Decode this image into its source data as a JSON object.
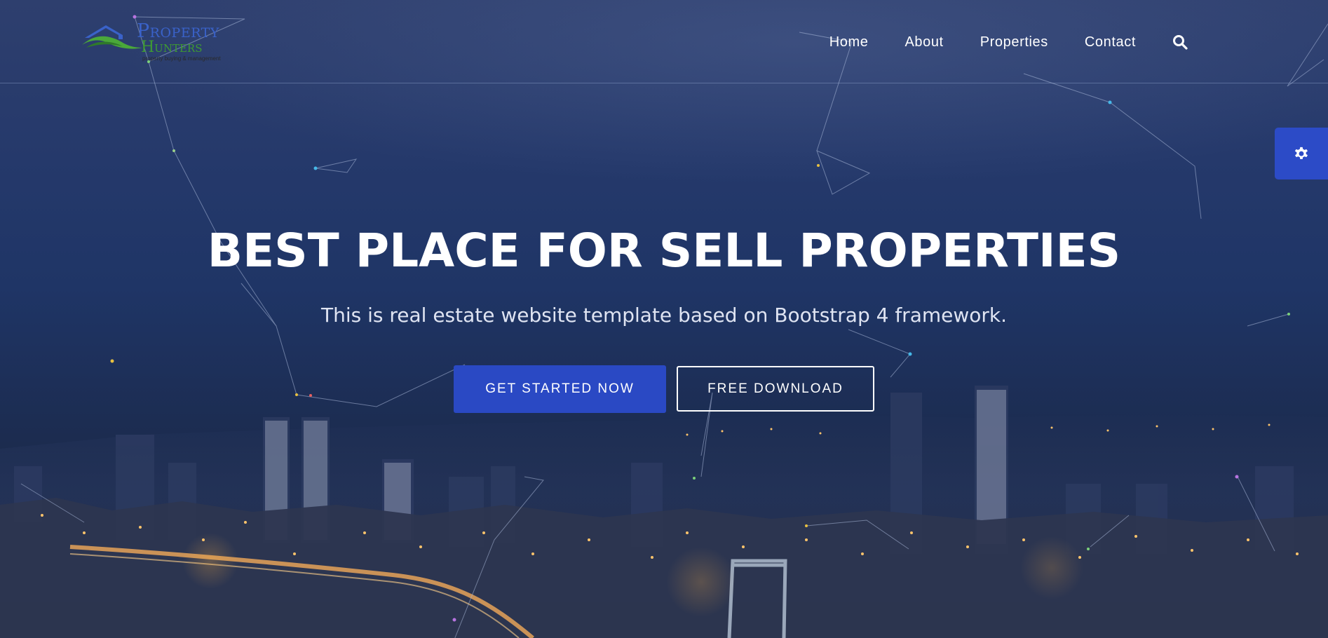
{
  "brand": {
    "name_line1": "Property",
    "name_line2": "Hunters",
    "tagline": "property buying & management",
    "colors": {
      "line1": "#3a62c9",
      "line2": "#3e9a32"
    }
  },
  "nav": {
    "items": [
      {
        "label": "Home"
      },
      {
        "label": "About"
      },
      {
        "label": "Properties"
      },
      {
        "label": "Contact"
      }
    ],
    "search_icon": "search-icon"
  },
  "settings_tab": {
    "icon": "gear-icon",
    "color": "#2c4bc7"
  },
  "hero": {
    "title": "BEST PLACE FOR SELL PROPERTIES",
    "subtitle": "This is real estate website template based on Bootstrap 4 framework.",
    "primary_button": "GET STARTED NOW",
    "secondary_button": "FREE DOWNLOAD",
    "accent_color": "#2a49c4"
  }
}
